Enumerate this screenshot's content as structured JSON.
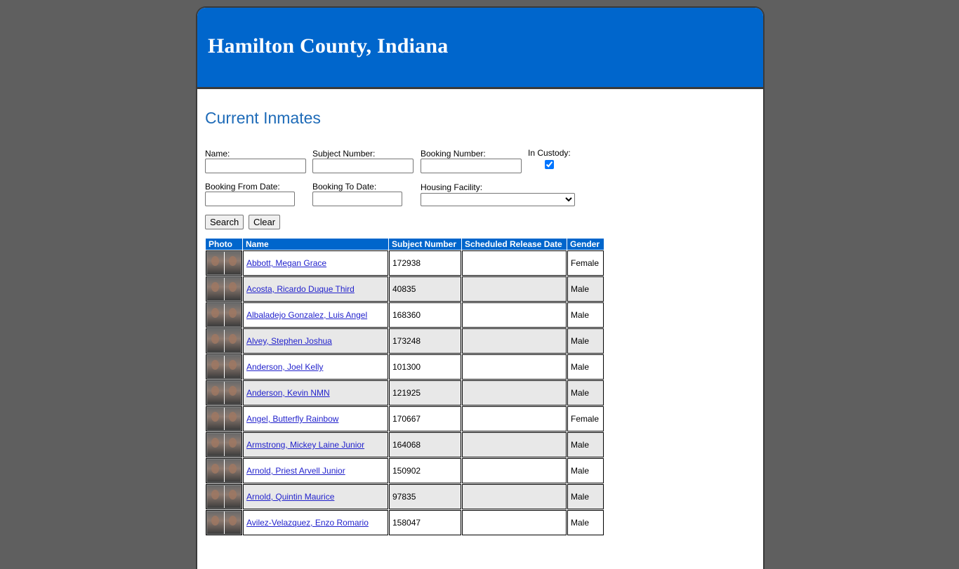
{
  "header": {
    "title": "Hamilton County, Indiana"
  },
  "page_title": "Current Inmates",
  "search_form": {
    "name_label": "Name:",
    "name_value": "",
    "subject_number_label": "Subject Number:",
    "subject_number_value": "",
    "booking_number_label": "Booking Number:",
    "booking_number_value": "",
    "in_custody_label": "In Custody:",
    "in_custody_checked": true,
    "booking_from_label": "Booking From Date:",
    "booking_from_value": "",
    "booking_to_label": "Booking To Date:",
    "booking_to_value": "",
    "housing_facility_label": "Housing Facility:",
    "housing_facility_selected": "",
    "search_button": "Search",
    "clear_button": "Clear"
  },
  "table": {
    "columns": [
      "Photo",
      "Name",
      "Subject Number",
      "Scheduled Release Date",
      "Gender"
    ],
    "rows": [
      {
        "name": "Abbott, Megan Grace",
        "subject_number": "172938",
        "release_date": "",
        "gender": "Female"
      },
      {
        "name": "Acosta, Ricardo Duque Third",
        "subject_number": "40835",
        "release_date": "",
        "gender": "Male"
      },
      {
        "name": "Albaladejo Gonzalez, Luis Angel",
        "subject_number": "168360",
        "release_date": "",
        "gender": "Male"
      },
      {
        "name": "Alvey, Stephen Joshua",
        "subject_number": "173248",
        "release_date": "",
        "gender": "Male"
      },
      {
        "name": "Anderson, Joel Kelly",
        "subject_number": "101300",
        "release_date": "",
        "gender": "Male"
      },
      {
        "name": "Anderson, Kevin NMN",
        "subject_number": "121925",
        "release_date": "",
        "gender": "Male"
      },
      {
        "name": "Angel, Butterfly Rainbow",
        "subject_number": "170667",
        "release_date": "",
        "gender": "Female"
      },
      {
        "name": "Armstrong, Mickey Laine Junior",
        "subject_number": "164068",
        "release_date": "",
        "gender": "Male"
      },
      {
        "name": "Arnold, Priest Arvell Junior",
        "subject_number": "150902",
        "release_date": "",
        "gender": "Male"
      },
      {
        "name": "Arnold, Quintin Maurice",
        "subject_number": "97835",
        "release_date": "",
        "gender": "Male"
      },
      {
        "name": "Avilez-Velazquez, Enzo Romario",
        "subject_number": "158047",
        "release_date": "",
        "gender": "Male"
      }
    ]
  },
  "colors": {
    "brand_blue": "#0066cc",
    "title_blue": "#1e6bb8",
    "background": "#5f5f5f",
    "row_alt": "#e8e8e8"
  }
}
